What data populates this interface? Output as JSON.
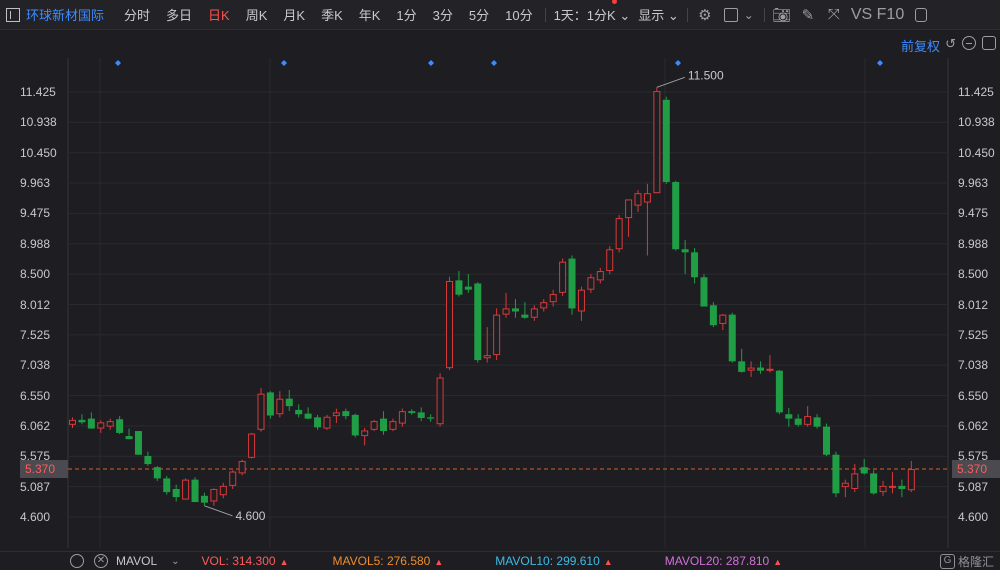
{
  "toolbar": {
    "stock_name": "环球新材国际",
    "timeframes": [
      "分时",
      "多日",
      "日K",
      "周K",
      "月K",
      "季K",
      "年K",
      "1分",
      "3分",
      "5分",
      "10分"
    ],
    "active_timeframe": "日K",
    "combo": "1天：1分K",
    "display": "显示",
    "vs_f10": "VS F10"
  },
  "subbar": {
    "adjust": "前复权"
  },
  "axis": {
    "y_ticks": [
      "11.425",
      "10.938",
      "10.450",
      "9.963",
      "9.475",
      "8.988",
      "8.500",
      "8.012",
      "7.525",
      "7.038",
      "6.550",
      "6.062",
      "5.575",
      "5.087",
      "4.600"
    ],
    "current_price": "5.370"
  },
  "annotations": {
    "high": "11.500",
    "low": "4.600"
  },
  "bottom": {
    "indicator": "MAVOL",
    "vol": "VOL: 314.300",
    "mavol5": "MAVOL5: 276.580",
    "mavol10": "MAVOL10: 299.610",
    "mavol20": "MAVOL20: 287.810",
    "logo": "格隆汇"
  },
  "colors": {
    "up": "#d7393a",
    "down": "#1f9e45",
    "accent": "#3d8bff",
    "vol": "#ff5c5c",
    "mavol5": "#f08c2a",
    "mavol10": "#3dbbe8",
    "mavol20": "#d66ee0"
  },
  "chart_data": {
    "type": "candlestick",
    "ylim": [
      4.4,
      11.75
    ],
    "ohlc": [
      [
        6.08,
        6.2,
        6.03,
        6.16
      ],
      [
        6.16,
        6.25,
        6.09,
        6.12
      ],
      [
        6.18,
        6.28,
        6.02,
        6.02
      ],
      [
        6.02,
        6.15,
        5.95,
        6.12
      ],
      [
        6.05,
        6.18,
        6.0,
        6.14
      ],
      [
        6.17,
        6.22,
        5.93,
        5.95
      ],
      [
        5.9,
        6.02,
        5.85,
        5.85
      ],
      [
        5.98,
        5.98,
        5.6,
        5.6
      ],
      [
        5.58,
        5.65,
        5.42,
        5.45
      ],
      [
        5.4,
        5.42,
        5.18,
        5.22
      ],
      [
        5.22,
        5.26,
        4.96,
        5.0
      ],
      [
        5.05,
        5.12,
        4.85,
        4.92
      ],
      [
        4.88,
        5.22,
        4.88,
        5.2
      ],
      [
        5.2,
        5.24,
        4.84,
        4.84
      ],
      [
        4.94,
        4.99,
        4.78,
        4.83
      ],
      [
        4.85,
        5.06,
        4.78,
        5.05
      ],
      [
        4.95,
        5.15,
        4.9,
        5.1
      ],
      [
        5.1,
        5.35,
        5.05,
        5.33
      ],
      [
        5.3,
        5.52,
        5.27,
        5.5
      ],
      [
        5.55,
        5.95,
        5.54,
        5.94
      ],
      [
        6.0,
        6.67,
        5.97,
        6.58
      ],
      [
        6.6,
        6.62,
        6.18,
        6.23
      ],
      [
        6.25,
        6.62,
        6.2,
        6.5
      ],
      [
        6.5,
        6.64,
        6.3,
        6.38
      ],
      [
        6.32,
        6.41,
        6.2,
        6.25
      ],
      [
        6.26,
        6.36,
        6.17,
        6.18
      ],
      [
        6.2,
        6.24,
        6.0,
        6.04
      ],
      [
        6.02,
        6.24,
        6.0,
        6.21
      ],
      [
        6.22,
        6.34,
        6.11,
        6.28
      ],
      [
        6.3,
        6.34,
        6.17,
        6.22
      ],
      [
        6.24,
        6.26,
        5.88,
        5.91
      ],
      [
        5.9,
        6.03,
        5.75,
        5.99
      ],
      [
        6.0,
        6.16,
        5.98,
        6.14
      ],
      [
        6.18,
        6.3,
        5.92,
        5.98
      ],
      [
        6.0,
        6.18,
        5.98,
        6.14
      ],
      [
        6.1,
        6.34,
        6.05,
        6.3
      ],
      [
        6.3,
        6.33,
        6.24,
        6.27
      ],
      [
        6.28,
        6.36,
        6.14,
        6.19
      ],
      [
        6.2,
        6.25,
        6.13,
        6.18
      ],
      [
        6.09,
        6.91,
        6.05,
        6.84
      ],
      [
        6.99,
        8.46,
        6.96,
        8.39
      ],
      [
        8.4,
        8.55,
        8.14,
        8.17
      ],
      [
        8.3,
        8.5,
        8.2,
        8.25
      ],
      [
        8.35,
        8.37,
        7.08,
        7.12
      ],
      [
        7.15,
        7.65,
        7.08,
        7.2
      ],
      [
        7.2,
        7.95,
        7.12,
        7.85
      ],
      [
        7.85,
        8.2,
        7.8,
        7.95
      ],
      [
        7.95,
        8.1,
        7.8,
        7.9
      ],
      [
        7.85,
        8.05,
        7.78,
        7.8
      ],
      [
        7.8,
        8.0,
        7.75,
        7.95
      ],
      [
        7.95,
        8.1,
        7.9,
        8.05
      ],
      [
        8.05,
        8.25,
        7.98,
        8.18
      ],
      [
        8.2,
        8.75,
        8.15,
        8.7
      ],
      [
        8.75,
        8.8,
        7.85,
        7.95
      ],
      [
        7.9,
        8.3,
        7.75,
        8.25
      ],
      [
        8.25,
        8.5,
        8.2,
        8.45
      ],
      [
        8.4,
        8.6,
        8.35,
        8.55
      ],
      [
        8.55,
        8.95,
        8.5,
        8.9
      ],
      [
        8.9,
        9.45,
        8.85,
        9.4
      ],
      [
        9.4,
        9.6,
        9.1,
        9.7
      ],
      [
        9.6,
        9.85,
        9.5,
        9.8
      ],
      [
        9.65,
        9.95,
        8.8,
        9.8
      ],
      [
        9.8,
        11.5,
        9.8,
        11.44
      ],
      [
        11.3,
        11.35,
        9.95,
        9.98
      ],
      [
        9.98,
        10.0,
        8.88,
        8.9
      ],
      [
        8.9,
        9.05,
        8.5,
        8.85
      ],
      [
        8.85,
        8.92,
        8.35,
        8.45
      ],
      [
        8.45,
        8.5,
        7.98,
        7.98
      ],
      [
        8.0,
        8.05,
        7.65,
        7.68
      ],
      [
        7.7,
        7.86,
        7.6,
        7.85
      ],
      [
        7.85,
        7.88,
        7.08,
        7.1
      ],
      [
        7.1,
        7.3,
        6.92,
        6.93
      ],
      [
        6.95,
        7.1,
        6.85,
        7.0
      ],
      [
        7.0,
        7.1,
        6.9,
        6.95
      ],
      [
        6.98,
        7.2,
        6.92,
        6.98
      ],
      [
        6.95,
        6.96,
        6.25,
        6.28
      ],
      [
        6.25,
        6.35,
        6.05,
        6.18
      ],
      [
        6.18,
        6.25,
        6.05,
        6.08
      ],
      [
        6.08,
        6.38,
        6.05,
        6.22
      ],
      [
        6.2,
        6.25,
        6.02,
        6.05
      ],
      [
        6.05,
        6.1,
        5.58,
        5.6
      ],
      [
        5.6,
        5.65,
        4.92,
        4.98
      ],
      [
        5.08,
        5.2,
        4.92,
        5.15
      ],
      [
        5.05,
        5.45,
        5.0,
        5.3
      ],
      [
        5.4,
        5.53,
        5.28,
        5.3
      ],
      [
        5.3,
        5.35,
        4.96,
        4.98
      ],
      [
        5.0,
        5.18,
        4.94,
        5.1
      ],
      [
        5.08,
        5.32,
        4.98,
        5.1
      ],
      [
        5.1,
        5.2,
        4.92,
        5.05
      ],
      [
        5.03,
        5.5,
        5.0,
        5.37
      ]
    ]
  }
}
